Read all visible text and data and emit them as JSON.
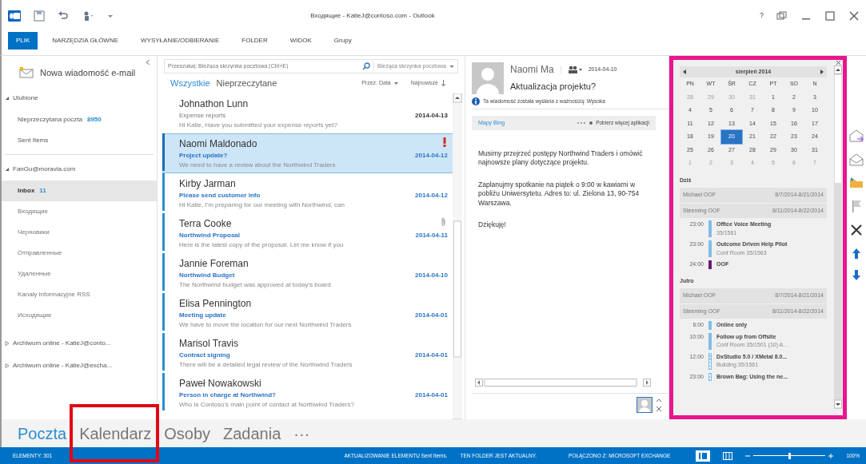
{
  "window": {
    "title": "Входящие - KatieJ@contoso.com - Outlook",
    "help": "?"
  },
  "ribbon_tabs": [
    {
      "label": "PLIK",
      "selected": true
    },
    {
      "label": "NARZĘDZIA GŁÓWNE",
      "selected": false
    },
    {
      "label": "WYSYŁANIE/ODBIERANIE",
      "selected": false
    },
    {
      "label": "FOLDER",
      "selected": false
    },
    {
      "label": "WIDOK",
      "selected": false
    },
    {
      "label": "Grupy",
      "selected": false
    }
  ],
  "folder_pane": {
    "new_button": "Nowa wiadomość e-mail",
    "groups": [
      {
        "label": "Ulubione",
        "expanded": true,
        "items": [
          {
            "label": "Nieprzeczytana poczta",
            "count": "8950",
            "selected": false
          },
          {
            "label": "Sent Items",
            "selected": false
          }
        ]
      },
      {
        "label": "FanGu@moravia.com",
        "expanded": true,
        "items": [
          {
            "label": "Inbox",
            "count": "11",
            "selected": true,
            "children": [
              {
                "label": "Входящие",
                "selected": false
              },
              {
                "label": "Черновики",
                "selected": false
              },
              {
                "label": "Отправленные",
                "selected": false
              },
              {
                "label": "Удаленные",
                "selected": false
              },
              {
                "label": "Kanały informacyjne RSS",
                "selected": false
              },
              {
                "label": "Исходящие",
                "selected": false
              }
            ]
          }
        ]
      }
    ],
    "archives": [
      {
        "label": "Archiwum online - KatieJ@conto...",
        "expanded": false
      },
      {
        "label": "Archiwum online - KatieJ@excha...",
        "expanded": false
      }
    ]
  },
  "message_list": {
    "search": {
      "placeholder": "Przeszukaj: Bieżąca skrzynka pocztowa (Ctrl+E)",
      "scope": "Bieżąca skrzynka pocztowa"
    },
    "filters": [
      {
        "label": "Wszystkie",
        "selected": true
      },
      {
        "label": "Nieprzeczytane",
        "selected": false
      }
    ],
    "sort_by": "Przez: Data",
    "order": "Najnowsze",
    "messages": [
      {
        "sender": "Johnathon Lunn",
        "subject": "Expense reports",
        "preview": "Hi Katie, Have you submitted your expense reports yet?",
        "date": "2014-04-13",
        "unread": false,
        "selected": false,
        "kind": "plain"
      },
      {
        "sender": "Naomi Maldonado",
        "subject": "Project update?",
        "preview": "We need to have a review about the Northwind Traders",
        "date": "2014-04-12",
        "unread": true,
        "selected": true,
        "kind": "important"
      },
      {
        "sender": "Kirby Jarman",
        "subject": "Please send customer info",
        "preview": "Hi Katie, I'm preparing for our meeting with Northwind, can",
        "date": "2014-04-12",
        "unread": true,
        "selected": false,
        "kind": "plain"
      },
      {
        "sender": "Terra Cooke",
        "subject": "Northwind Proposal",
        "preview": "Here is the latest copy of the proposal. Let me know if you",
        "date": "2014-04-11",
        "unread": true,
        "selected": false,
        "kind": "attachment"
      },
      {
        "sender": "Jannie Foreman",
        "subject": "Northwind Budget",
        "preview": "The Northwind budget was approved at today's board",
        "date": "2014-04-10",
        "unread": true,
        "selected": false,
        "kind": "plain"
      },
      {
        "sender": "Elisa Pennington",
        "subject": "Meeting update",
        "preview": "We have to move the location for our next Northwind Traders",
        "date": "2014-04-01",
        "unread": true,
        "selected": false,
        "kind": "plain"
      },
      {
        "sender": "Marisol Travis",
        "subject": "Contract signing",
        "preview": "There will be a detailed legal review of the Northwind Traders",
        "date": "2014-04-01",
        "unread": true,
        "selected": false,
        "kind": "plain"
      },
      {
        "sender": "Paweł Nowakowski",
        "subject": "Person in charge at Northwind?",
        "preview": "Who is Contoso's main point of contact at Northwind Traders?",
        "date": "2014-04-01",
        "unread": true,
        "selected": false,
        "kind": "plain"
      }
    ]
  },
  "reading_pane": {
    "sender": "Naomi Ma",
    "date": "2014-04-10",
    "subject": "Aktualizacja projektu?",
    "info": "Ta wiadomość została wysłana z ważnością: Wysoka",
    "apps": {
      "app": "Mapy Bing",
      "more": "Pobierz więcej aplikacji"
    },
    "body": [
      "Musimy przejrzeć postępy Northwind Traders i omówić najnowsze plany dotyczące projektu.",
      "Zaplanujmy spotkanie na piątek o 9:00 w kawiarni w pobliżu Uniwersytetu. Adres to: ul. Zielona 13, 90-754 Warszawa.",
      "Dziękuję!"
    ]
  },
  "calendar_peek": {
    "highlighted": true,
    "month": "sierpień 2014",
    "weekdays": [
      "PN",
      "WT",
      "ŚR",
      "CZ",
      "PT",
      "SO",
      "N"
    ],
    "weeks": [
      [
        {
          "day": "28",
          "other_month": true,
          "selected": false
        },
        {
          "day": "29",
          "other_month": true,
          "selected": false
        },
        {
          "day": "30",
          "other_month": true,
          "selected": false
        },
        {
          "day": "31",
          "other_month": true,
          "selected": false
        },
        {
          "day": "1",
          "other_month": false,
          "selected": false
        },
        {
          "day": "2",
          "other_month": false,
          "selected": false
        },
        {
          "day": "3",
          "other_month": false,
          "selected": false
        }
      ],
      [
        {
          "day": "4",
          "other_month": false,
          "selected": false
        },
        {
          "day": "5",
          "other_month": false,
          "selected": false
        },
        {
          "day": "6",
          "other_month": false,
          "selected": false
        },
        {
          "day": "7",
          "other_month": false,
          "selected": false
        },
        {
          "day": "8",
          "other_month": false,
          "selected": false
        },
        {
          "day": "9",
          "other_month": false,
          "selected": false
        },
        {
          "day": "10",
          "other_month": false,
          "selected": false
        }
      ],
      [
        {
          "day": "11",
          "other_month": false,
          "selected": false
        },
        {
          "day": "12",
          "other_month": false,
          "selected": false
        },
        {
          "day": "13",
          "other_month": false,
          "selected": false
        },
        {
          "day": "14",
          "other_month": false,
          "selected": false
        },
        {
          "day": "15",
          "other_month": false,
          "selected": false
        },
        {
          "day": "16",
          "other_month": false,
          "selected": false
        },
        {
          "day": "17",
          "other_month": false,
          "selected": false
        }
      ],
      [
        {
          "day": "18",
          "other_month": false,
          "selected": false
        },
        {
          "day": "19",
          "other_month": false,
          "selected": false
        },
        {
          "day": "20",
          "other_month": false,
          "selected": true
        },
        {
          "day": "21",
          "other_month": false,
          "selected": false
        },
        {
          "day": "22",
          "other_month": false,
          "selected": false
        },
        {
          "day": "23",
          "other_month": false,
          "selected": false
        },
        {
          "day": "24",
          "other_month": false,
          "selected": false
        }
      ],
      [
        {
          "day": "25",
          "other_month": false,
          "selected": false
        },
        {
          "day": "26",
          "other_month": false,
          "selected": false
        },
        {
          "day": "27",
          "other_month": false,
          "selected": false
        },
        {
          "day": "28",
          "other_month": false,
          "selected": false
        },
        {
          "day": "29",
          "other_month": false,
          "selected": false
        },
        {
          "day": "30",
          "other_month": false,
          "selected": false
        },
        {
          "day": "31",
          "other_month": false,
          "selected": false
        }
      ],
      [
        {
          "day": "1",
          "other_month": true,
          "selected": false
        },
        {
          "day": "2",
          "other_month": true,
          "selected": false
        },
        {
          "day": "3",
          "other_month": true,
          "selected": false
        },
        {
          "day": "4",
          "other_month": true,
          "selected": false
        },
        {
          "day": "5",
          "other_month": true,
          "selected": false
        },
        {
          "day": "6",
          "other_month": true,
          "selected": false
        },
        {
          "day": "7",
          "other_month": true,
          "selected": false
        }
      ]
    ],
    "agenda": [
      {
        "heading": "Dziś",
        "all_day": [
          {
            "name": "Michael OOF",
            "dates": "8/7/2014-8/21/2014"
          },
          {
            "name": "Steeming OOF",
            "dates": "8/11/2014-8/22/2014"
          }
        ],
        "events": [
          {
            "time": "23:00",
            "title": "Office Voice Meeting",
            "location": "35/1561",
            "color": "#7fbde8",
            "tentative": false
          },
          {
            "time": "23:00",
            "title": "Outcome Driven Help Pilot",
            "location": "Conf Room 35/1563",
            "color": "#7fbde8",
            "tentative": false
          },
          {
            "time": "24:00",
            "title": "OOF",
            "color": "#6a1b6f",
            "tentative": false
          }
        ]
      },
      {
        "heading": "Jutro",
        "all_day": [
          {
            "name": "Michael OOF",
            "dates": "8/7/2014-8/21/2014"
          },
          {
            "name": "Steeming OOF",
            "dates": "8/11/2014-8/22/2014"
          }
        ],
        "events": [
          {
            "time": "6:00",
            "title": "Online only",
            "color": "#7fbde8",
            "tentative": false
          },
          {
            "time": "10:00",
            "title": "Follow up from Offsite",
            "location": "Conf Room 35/1501 (10) A...",
            "color": "#7fbde8",
            "tentative": false
          },
          {
            "time": "12:00",
            "title": "DxStudio 5.0 / XMetal 8.0...",
            "location": "Building 35/1561",
            "color": "#7fbde8",
            "tentative": true
          },
          {
            "time": "23:00",
            "title": "Brown Bag: Using the ne...",
            "color": "#7fbde8",
            "tentative": true
          }
        ]
      }
    ]
  },
  "navigation": [
    {
      "label": "Poczta",
      "selected": true,
      "highlighted": false
    },
    {
      "label": "Kalendarz",
      "selected": false,
      "highlighted": true
    },
    {
      "label": "Osoby",
      "selected": false,
      "highlighted": false
    },
    {
      "label": "Zadania",
      "selected": false,
      "highlighted": false
    },
    {
      "label": "···",
      "selected": false,
      "highlighted": false
    }
  ],
  "status_bar": {
    "items": "ELEMENTY: 301",
    "sync": "AKTUALIZOWANIE ELEMENTU Sent Items.",
    "folder": "TEN FOLDER JEST AKTUALNY.",
    "connection": "POŁĄCZONO Z: MICROSOFT EXCHANGE",
    "zoom": {
      "level": 0.5,
      "reading": "100%"
    }
  }
}
